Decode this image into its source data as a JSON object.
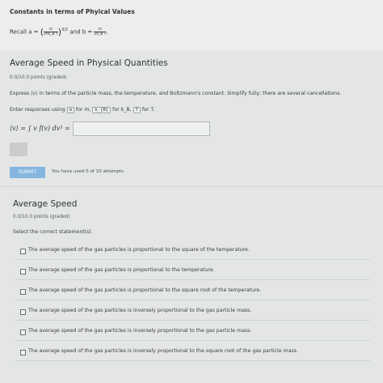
{
  "header": {
    "title": "Constants in terms of Phyical Values",
    "recall_prefix": "Recall a =",
    "a_numerator": "m",
    "a_denominator": "2πk_B T",
    "a_exponent": "3/2",
    "connector": "and b =",
    "b_numerator": "m",
    "b_denominator": "2k_B T",
    "trailing": "."
  },
  "problem1": {
    "title": "Average Speed in Physical Quantities",
    "points": "0.0/10.0 points (graded)",
    "instruction": "Express ⟨v⟩ in terms of the particle mass, the temperature, and Boltzmann's constant. Simplify fully; there are several cancellations.",
    "enter_prefix": "Enter responses using",
    "code_m": "m",
    "for_m": "for m,",
    "code_kb": "k_{B}",
    "for_kb": "for k_B,",
    "code_t": "T",
    "for_t": "for T.",
    "answer_label": "⟨v⟩ = ∫ v f(v) dv³ =",
    "answer_value": "",
    "submit_label": "SUBMIT",
    "attempts_text": "You have used 0 of 10 attempts"
  },
  "problem2": {
    "title": "Average Speed",
    "points": "0.0/10.0 points (graded)",
    "prompt": "Select the correct statement(s).",
    "options": [
      {
        "label": "The average speed of the gas particles is proportional to the square of the temperature.",
        "checked": false
      },
      {
        "label": "The average speed of the gas particles is proportional to the temperature.",
        "checked": false
      },
      {
        "label": "The average speed of the gas particles is proportional to the square root of the temperature.",
        "checked": false
      },
      {
        "label": "The average speed of the gas particles is inversely proportional to the gas particle mass.",
        "checked": false
      },
      {
        "label": "The average speed of the gas particles is inversely proportional to the gas particle mass.",
        "checked": false
      },
      {
        "label": "The average speed of the gas particles is inversely proportional to the square root of the gas particle mass.",
        "checked": false
      }
    ]
  },
  "colors": {
    "submit": "#86b6e0",
    "background": "#e4e6e6"
  }
}
